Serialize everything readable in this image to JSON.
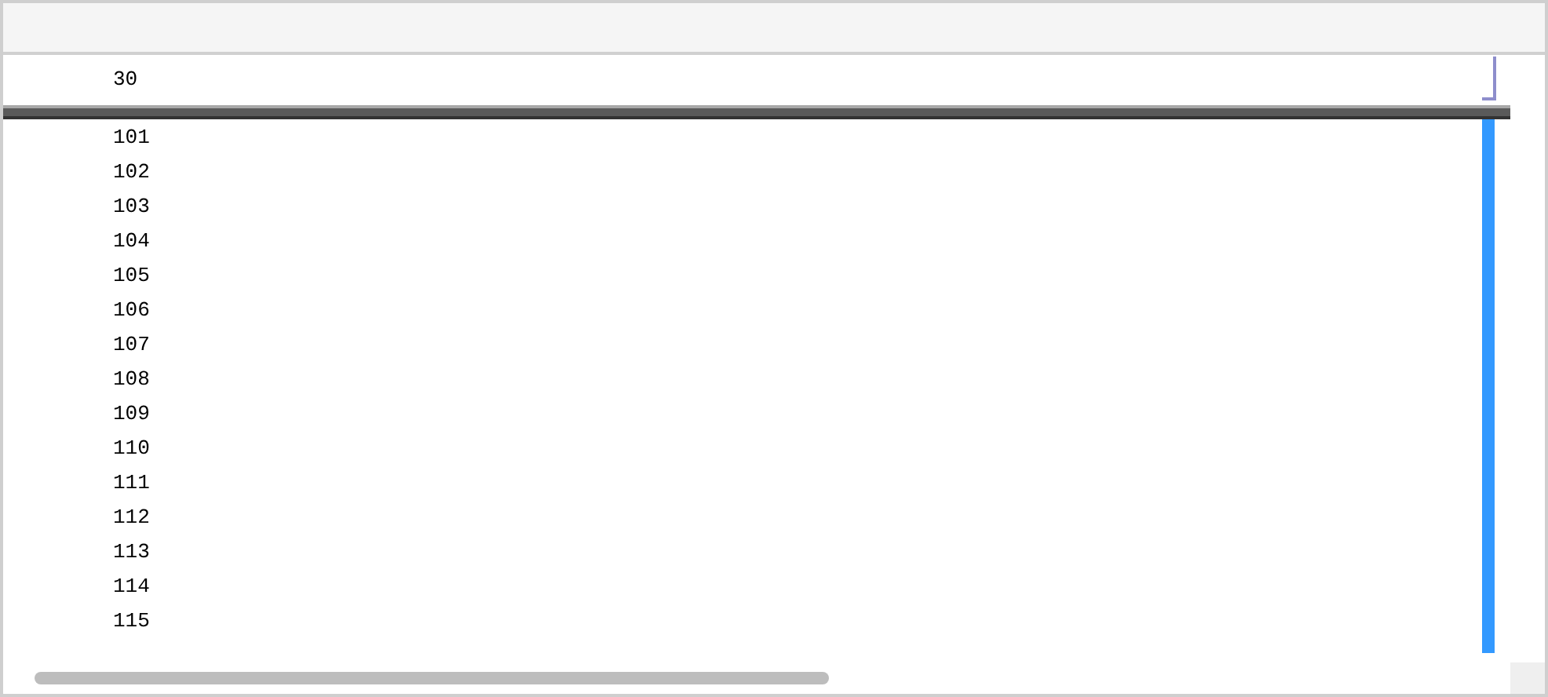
{
  "frozen_row": {
    "line_number": "30"
  },
  "rows": [
    {
      "line_number": "101"
    },
    {
      "line_number": "102"
    },
    {
      "line_number": "103"
    },
    {
      "line_number": "104"
    },
    {
      "line_number": "105"
    },
    {
      "line_number": "106"
    },
    {
      "line_number": "107"
    },
    {
      "line_number": "108"
    },
    {
      "line_number": "109"
    },
    {
      "line_number": "110"
    },
    {
      "line_number": "111"
    },
    {
      "line_number": "112"
    },
    {
      "line_number": "113"
    },
    {
      "line_number": "114"
    },
    {
      "line_number": "115"
    }
  ]
}
